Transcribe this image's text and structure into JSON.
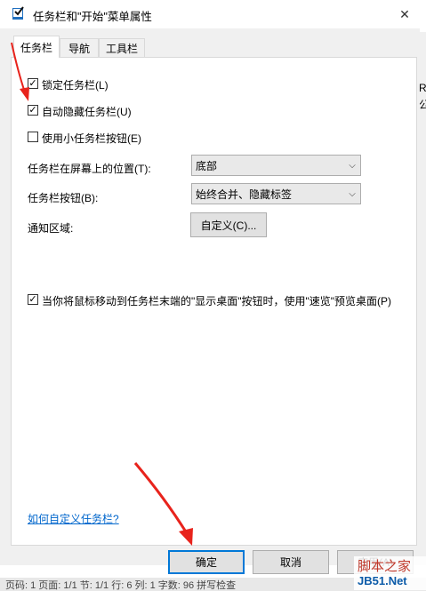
{
  "window": {
    "title": "任务栏和\"开始\"菜单属性",
    "close_glyph": "✕",
    "icon": "taskbar-properties-icon"
  },
  "background": {
    "right_chars": [
      "R",
      "公"
    ]
  },
  "tabs": [
    {
      "label": "任务栏",
      "active": true
    },
    {
      "label": "导航",
      "active": false
    },
    {
      "label": "工具栏",
      "active": false
    }
  ],
  "checkboxes": {
    "lock_taskbar": {
      "label": "锁定任务栏(L)",
      "checked": true
    },
    "auto_hide": {
      "label": "自动隐藏任务栏(U)",
      "checked": true
    },
    "small_buttons": {
      "label": "使用小任务栏按钮(E)",
      "checked": false
    },
    "peek": {
      "label": "当你将鼠标移动到任务栏末端的\"显示桌面\"按钮时，使用\"速览\"预览桌面(P)",
      "checked": true
    }
  },
  "settings": {
    "position_label": "任务栏在屏幕上的位置(T):",
    "position_value": "底部",
    "buttons_label": "任务栏按钮(B):",
    "buttons_value": "始终合并、隐藏标签",
    "notification_label": "通知区域:",
    "customize_button": "自定义(C)..."
  },
  "help_link": "如何自定义任务栏?",
  "footer": {
    "ok": "确定",
    "cancel": "取消",
    "apply": "应用(A)"
  },
  "statusbar": {
    "text": "页码: 1   页面: 1/1   节: 1/1   行: 6   列: 1   字数: 96   拼写检查"
  },
  "watermark": {
    "top": "脚本之家",
    "bottom": "JB51.Net"
  },
  "colors": {
    "accent": "#0078d7",
    "link": "#0066cc",
    "arrow": "#e8231c"
  }
}
